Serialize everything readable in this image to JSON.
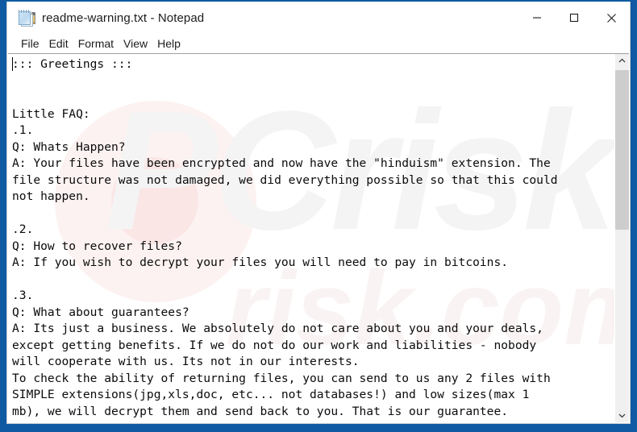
{
  "window": {
    "title": "readme-warning.txt - Notepad",
    "icon": "notepad-icon",
    "controls": {
      "minimize_label": "Minimize",
      "maximize_label": "Maximize",
      "close_label": "Close"
    }
  },
  "menu": {
    "items": [
      {
        "label": "File"
      },
      {
        "label": "Edit"
      },
      {
        "label": "Format"
      },
      {
        "label": "View"
      },
      {
        "label": "Help"
      }
    ]
  },
  "editor": {
    "content": "::: Greetings :::\n\n\nLittle FAQ:\n.1.\nQ: Whats Happen?\nA: Your files have been encrypted and now have the \"hinduism\" extension. The\nfile structure was not damaged, we did everything possible so that this could\nnot happen.\n\n.2.\nQ: How to recover files?\nA: If you wish to decrypt your files you will need to pay in bitcoins.\n\n.3.\nQ: What about guarantees?\nA: Its just a business. We absolutely do not care about you and your deals,\nexcept getting benefits. If we do not do our work and liabilities - nobody\nwill cooperate with us. Its not in our interests.\nTo check the ability of returning files, you can send to us any 2 files with\nSIMPLE extensions(jpg,xls,doc, etc... not databases!) and low sizes(max 1\nmb), we will decrypt them and send back to you. That is our guarantee.",
    "watermark_text": "PCrisk",
    "watermark_secondary": "risk.com"
  },
  "scrollbar": {
    "up_arrow": "chevron-up-icon",
    "down_arrow": "chevron-down-icon",
    "thumb_position_percent": 0,
    "thumb_size_percent": 48
  },
  "colors": {
    "desktop_blue": "#0f5aa2",
    "window_bg": "#ffffff",
    "text": "#0b0b0b",
    "scrollbar_track": "#f0f0f0",
    "scrollbar_thumb": "#cdcdcd"
  }
}
